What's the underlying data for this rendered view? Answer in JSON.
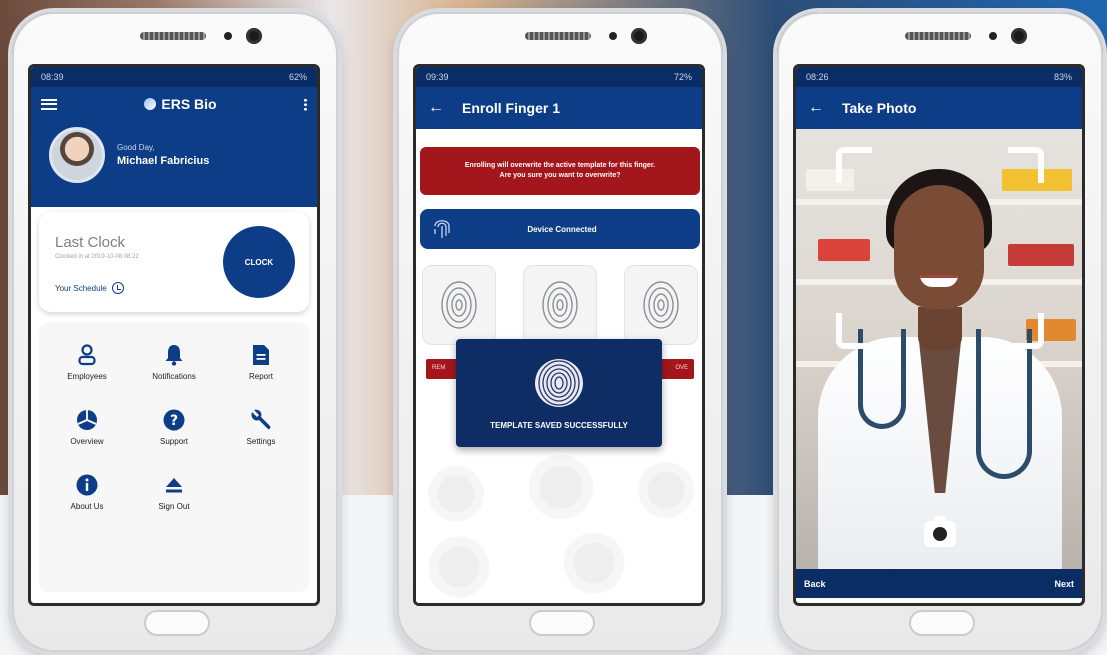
{
  "colors": {
    "primary": "#0d3d87",
    "dark_bar": "#0b2d66",
    "warning": "#a3171c"
  },
  "phone1": {
    "status_time": "08:39",
    "status_battery": "62%",
    "brand": "ERS Bio",
    "greeting": "Good Day,",
    "user_name": "Michael Fabricius",
    "last_clock_title": "Last Clock",
    "last_clock_sub": "Clocked in at 2019-10-08 08:22",
    "schedule_label": "Your Schedule",
    "clock_button": "CLOCK",
    "menu": [
      {
        "label": "Employees",
        "icon": "person-icon"
      },
      {
        "label": "Notifications",
        "icon": "bell-icon"
      },
      {
        "label": "Report",
        "icon": "document-icon"
      },
      {
        "label": "Overview",
        "icon": "pie-chart-icon"
      },
      {
        "label": "Support",
        "icon": "help-icon"
      },
      {
        "label": "Settings",
        "icon": "wrench-icon"
      },
      {
        "label": "About Us",
        "icon": "info-icon"
      },
      {
        "label": "Sign Out",
        "icon": "eject-icon"
      }
    ]
  },
  "phone2": {
    "status_time": "09:39",
    "status_battery": "72%",
    "title": "Enroll Finger 1",
    "warning_line1": "Enrolling will overwrite the active template for this finger.",
    "warning_line2": "Are you sure you want to overwrite?",
    "device_status": "Device Connected",
    "remove_left": "REM",
    "remove_right": "OVE",
    "toast_text": "TEMPLATE SAVED SUCCESSFULLY"
  },
  "phone3": {
    "status_time": "08:26",
    "status_battery": "83%",
    "title": "Take Photo",
    "back_label": "Back",
    "next_label": "Next"
  }
}
